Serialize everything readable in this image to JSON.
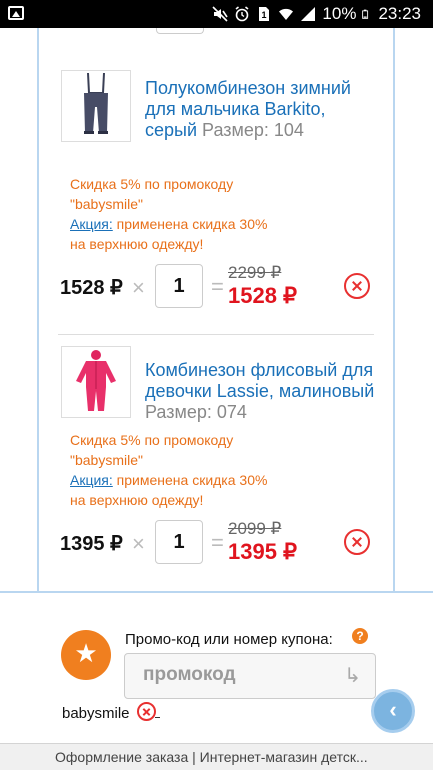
{
  "status_bar": {
    "battery_text": "10%",
    "time": "23:23",
    "icons": [
      "gallery-icon",
      "mute-icon",
      "alarm-icon",
      "sim-icon",
      "wifi-icon",
      "signal-icon",
      "battery-icon"
    ]
  },
  "cart": {
    "items": [
      {
        "title": "Полукомбинезон зимний для мальчика Barkito, серый",
        "size_label": "Размер: 104",
        "promo_line1": "Скидка 5% по промокоду",
        "promo_line2": "\"babysmile\"",
        "action_link": "Акция:",
        "action_text1": "применена скидка 30%",
        "action_text2": "на верхнюю одежду!",
        "unit_price": "1528 ₽",
        "quantity": "1",
        "old_price": "2299 ₽",
        "new_price": "1528 ₽",
        "image": "navy-bib-snowpants"
      },
      {
        "title": "Комбинезон флисовый для девочки Lassie, малиновый",
        "size_label": "Размер: 074",
        "promo_line1": "Скидка 5% по промокоду",
        "promo_line2": "\"babysmile\"",
        "action_link": "Акция:",
        "action_text1": "применена скидка 30%",
        "action_text2": "на верхнюю одежду!",
        "unit_price": "1395 ₽",
        "quantity": "1",
        "old_price": "2099 ₽",
        "new_price": "1395 ₽",
        "image": "pink-fleece-jumpsuit"
      }
    ],
    "times_symbol": "×",
    "equals_symbol": "="
  },
  "coupon": {
    "label": "Промо-код или номер купона:",
    "help": "?",
    "placeholder": "промокод",
    "applied_code": "babysmile"
  },
  "browser_bottom": {
    "page_title": "Оформление заказа | Интернет-магазин детск..."
  },
  "colors": {
    "link_blue": "#1a70b8",
    "promo_orange": "#e8701a",
    "price_red": "#e0141e",
    "badge_orange": "#f07f1f"
  }
}
